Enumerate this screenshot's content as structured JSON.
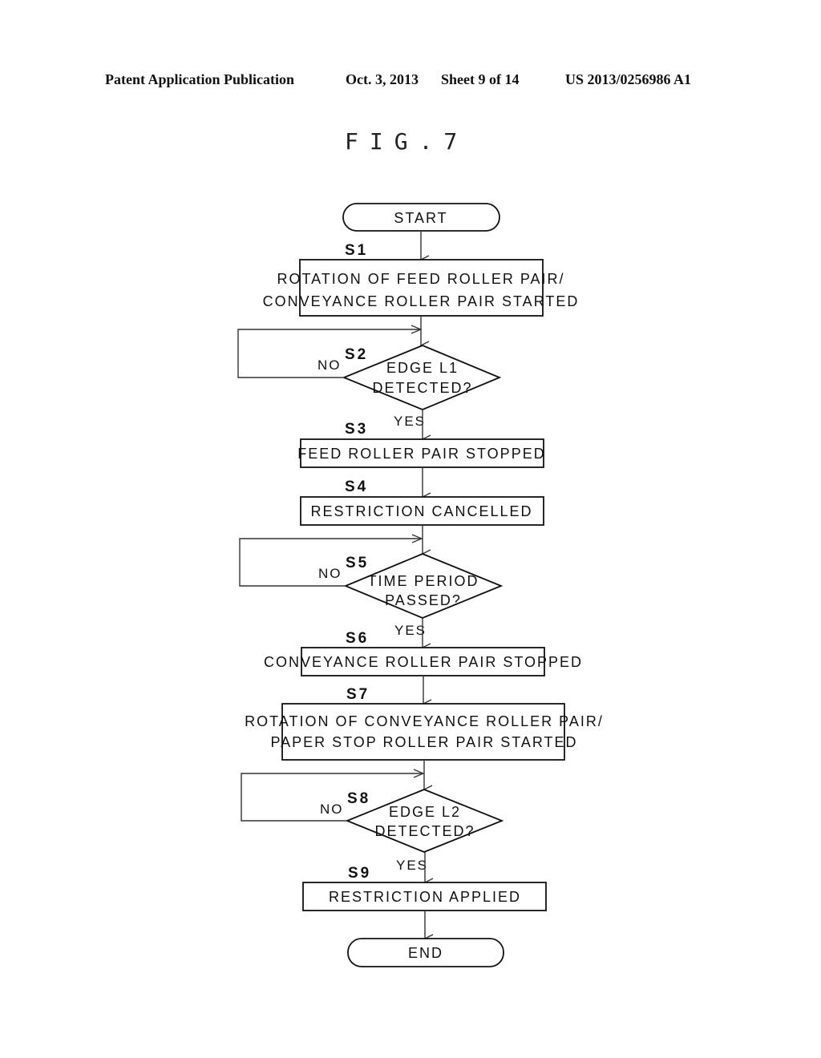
{
  "header": {
    "publication": "Patent Application Publication",
    "date": "Oct. 3, 2013",
    "sheet": "Sheet 9 of 14",
    "number": "US 2013/0256986 A1"
  },
  "figure": {
    "title": "FIG.7"
  },
  "flowchart": {
    "start": "START",
    "end": "END",
    "steps": [
      {
        "id": "S1",
        "type": "process",
        "lines": [
          "ROTATION OF FEED ROLLER PAIR/",
          "CONVEYANCE ROLLER PAIR STARTED"
        ]
      },
      {
        "id": "S2",
        "type": "decision",
        "lines": [
          "EDGE L1",
          "DETECTED?"
        ],
        "yes": "YES",
        "no": "NO"
      },
      {
        "id": "S3",
        "type": "process",
        "lines": [
          "FEED ROLLER PAIR STOPPED"
        ]
      },
      {
        "id": "S4",
        "type": "process",
        "lines": [
          "RESTRICTION CANCELLED"
        ]
      },
      {
        "id": "S5",
        "type": "decision",
        "lines": [
          "TIME PERIOD",
          "PASSED?"
        ],
        "yes": "YES",
        "no": "NO"
      },
      {
        "id": "S6",
        "type": "process",
        "lines": [
          "CONVEYANCE ROLLER PAIR STOPPED"
        ]
      },
      {
        "id": "S7",
        "type": "process",
        "lines": [
          "ROTATION OF CONVEYANCE ROLLER PAIR/",
          "PAPER STOP ROLLER PAIR STARTED"
        ]
      },
      {
        "id": "S8",
        "type": "decision",
        "lines": [
          "EDGE L2",
          "DETECTED?"
        ],
        "yes": "YES",
        "no": "NO"
      },
      {
        "id": "S9",
        "type": "process",
        "lines": [
          "RESTRICTION APPLIED"
        ]
      }
    ]
  }
}
